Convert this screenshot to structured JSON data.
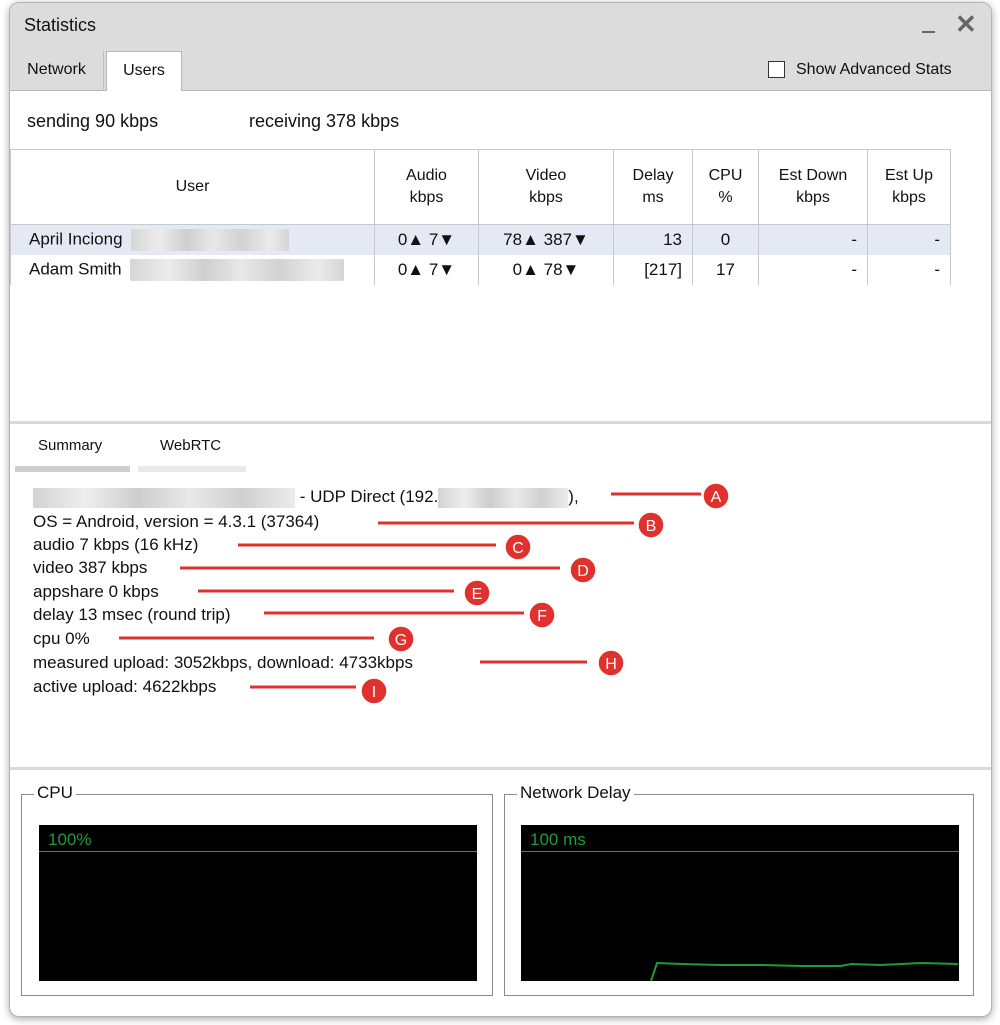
{
  "window": {
    "title": "Statistics"
  },
  "tabs": [
    {
      "label": "Network"
    },
    {
      "label": "Users"
    }
  ],
  "advanced_stats": {
    "label": "Show Advanced Stats",
    "checked": false
  },
  "rates": {
    "sending": "sending 90 kbps",
    "receiving": "receiving 378 kbps"
  },
  "table": {
    "headers": [
      [
        "User"
      ],
      [
        "Audio",
        "kbps"
      ],
      [
        "Video",
        "kbps"
      ],
      [
        "Delay",
        "ms"
      ],
      [
        "CPU",
        "%"
      ],
      [
        "Est Down",
        "kbps"
      ],
      [
        "Est Up",
        "kbps"
      ]
    ],
    "rows": [
      {
        "user": "April Inciong",
        "audio": "0▲  7▼",
        "video": "78▲  387▼",
        "delay": "13",
        "cpu": "0",
        "est_down": "-",
        "est_up": "-"
      },
      {
        "user": "Adam Smith",
        "audio": "0▲  7▼",
        "video": "0▲  78▼",
        "delay": "[217]",
        "cpu": "17",
        "est_down": "-",
        "est_up": "-"
      }
    ]
  },
  "subtabs": [
    {
      "label": "Summary"
    },
    {
      "label": "WebRTC"
    }
  ],
  "summary": {
    "connection_prefix": "- UDP Direct (192.",
    "connection_suffix": "),",
    "lines": [
      "OS = Android, version = 4.3.1 (37364)",
      "audio 7 kbps (16 kHz)",
      "video 387 kbps",
      "appshare 0 kbps",
      "delay 13 msec (round trip)",
      "cpu 0%",
      "measured upload: 3052kbps, download: 4733kbps",
      "active upload: 4622kbps"
    ]
  },
  "annotations": {
    "color": "#e0312f",
    "markers": [
      "A",
      "B",
      "C",
      "D",
      "E",
      "F",
      "G",
      "H",
      "I"
    ]
  },
  "graphs": {
    "cpu": {
      "title": "CPU",
      "scale_label": "100%"
    },
    "network": {
      "title": "Network Delay",
      "scale_label": "100 ms"
    },
    "color": "#1c9b3d"
  }
}
